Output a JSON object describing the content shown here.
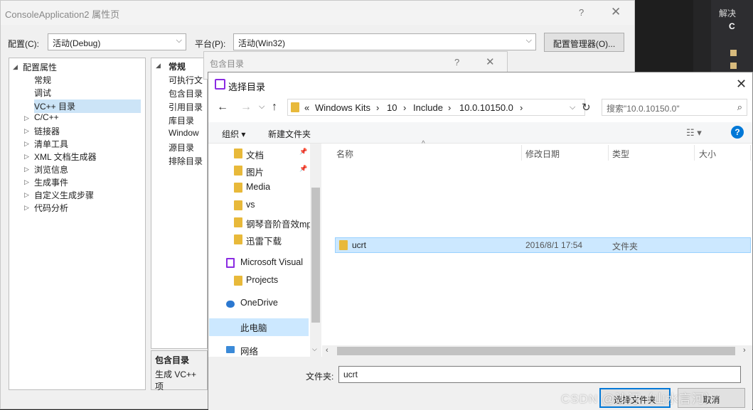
{
  "props": {
    "title": "ConsoleApplication2 属性页",
    "help": "?",
    "close": "✕",
    "config_label": "配置(C):",
    "config_value": "活动(Debug)",
    "platform_label": "平台(P):",
    "platform_value": "活动(Win32)",
    "config_manager": "配置管理器(O)...",
    "tree": [
      {
        "label": "配置属性",
        "twisty": "◢"
      },
      {
        "label": "常规"
      },
      {
        "label": "调试"
      },
      {
        "label": "VC++ 目录"
      },
      {
        "label": "C/C++",
        "twisty": "▷"
      },
      {
        "label": "链接器",
        "twisty": "▷"
      },
      {
        "label": "清单工具",
        "twisty": "▷"
      },
      {
        "label": "XML 文档生成器",
        "twisty": "▷"
      },
      {
        "label": "浏览信息",
        "twisty": "▷"
      },
      {
        "label": "生成事件",
        "twisty": "▷"
      },
      {
        "label": "自定义生成步骤",
        "twisty": "▷"
      },
      {
        "label": "代码分析",
        "twisty": "▷"
      }
    ],
    "grid_header": "常规",
    "grid_items": [
      "可执行文",
      "包含目录",
      "引用目录",
      "库目录",
      "Window",
      "源目录",
      "排除目录"
    ],
    "desc_title": "包含目录",
    "desc_text": "生成 VC++ 项"
  },
  "include_dialog": {
    "title": "包含目录",
    "help": "?",
    "close": "✕"
  },
  "select_dialog": {
    "title": "选择目录",
    "close": "✕",
    "breadcrumb": [
      "«",
      "Windows Kits",
      "›",
      "10",
      "›",
      "Include",
      "›",
      "10.0.10150.0",
      "›"
    ],
    "search_placeholder": "搜索\"10.0.10150.0\"",
    "organize": "组织 ▾",
    "new_folder": "新建文件夹",
    "help": "?",
    "nav": [
      {
        "label": "文档",
        "pin": "📌"
      },
      {
        "label": "图片",
        "pin": "📌"
      },
      {
        "label": "Media"
      },
      {
        "label": "vs"
      },
      {
        "label": "钢琴音阶音效mp"
      },
      {
        "label": "迅雷下载"
      },
      {
        "label": "Microsoft Visual"
      },
      {
        "label": "Projects"
      },
      {
        "label": "OneDrive"
      },
      {
        "label": "此电脑"
      },
      {
        "label": "网络"
      }
    ],
    "columns": [
      "名称",
      "修改日期",
      "类型",
      "大小"
    ],
    "rows": [
      {
        "name": "ucrt",
        "date": "2016/8/1 17:54",
        "type": "文件夹",
        "size": ""
      }
    ],
    "folder_label": "文件夹:",
    "folder_value": "ucrt",
    "ok": "选择文件夹",
    "cancel": "取消"
  },
  "vs": {
    "solution_label": "解决",
    "solution_c": "C"
  },
  "watermark": "CSDN @沙汀（山水言河）",
  "colors": {
    "accent": "#0078d7",
    "selection": "#cce8ff",
    "folder": "#e8b93a"
  }
}
